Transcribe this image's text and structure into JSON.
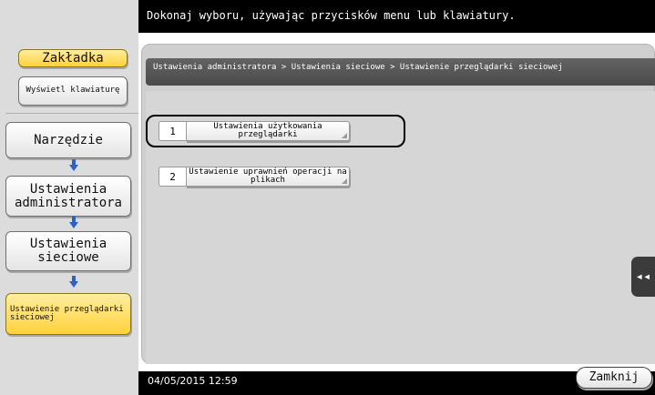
{
  "header": {
    "instruction": "Dokonaj wyboru, używając przycisków menu lub klawiatury."
  },
  "sidebar": {
    "tab_label": "Zakładka",
    "keyboard_label": "Wyświetl klawiaturę",
    "nav": [
      {
        "label": "Narzędzie"
      },
      {
        "label": "Ustawienia administratora"
      },
      {
        "label": "Ustawienia sieciowe"
      },
      {
        "label": "Ustawienie przeglądarki sieciowej"
      }
    ]
  },
  "breadcrumb": {
    "text": "Ustawienia administratora > Ustawienia sieciowe > Ustawienie przeglądarki sieciowej"
  },
  "options": [
    {
      "number": "1",
      "label": "Ustawienia użytkowania przeglądarki"
    },
    {
      "number": "2",
      "label": "Ustawienie uprawnień operacji na plikach"
    }
  ],
  "footer": {
    "datetime": "04/05/2015  12:59",
    "close_label": "Zamknij"
  },
  "side_tab": {
    "icon": "double-chevron-left-icon",
    "glyph": "◂◂"
  },
  "colors": {
    "accent_yellow": "#ffd23a",
    "arrow_blue": "#2a62c8"
  }
}
